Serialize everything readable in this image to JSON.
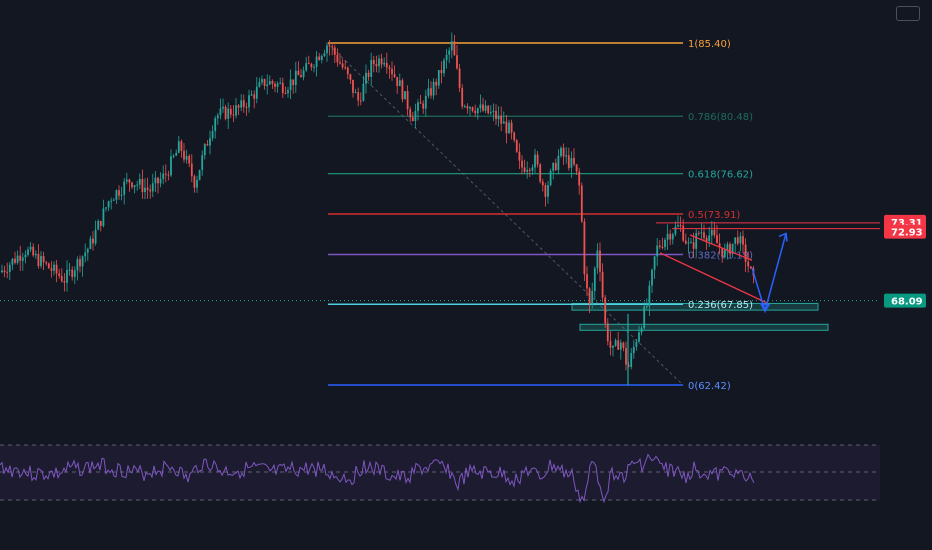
{
  "colors": {
    "background": "#131722",
    "candle_up": "#26a69a",
    "candle_down": "#ef5350",
    "rsi_line": "#7e57c2",
    "rsi_band": "#2a2240",
    "arrow": "#2962ff"
  },
  "fib_levels": [
    {
      "ratio": "1",
      "price": 85.4,
      "label": "1(85.40)",
      "color": "#f7a037",
      "label_color": "#f7a037",
      "line_width": 1.5
    },
    {
      "ratio": "0.786",
      "price": 80.48,
      "label": "0.786(80.48)",
      "color": "#1e6b5a",
      "label_color": "#1e6b5a",
      "line_width": 1.2
    },
    {
      "ratio": "0.618",
      "price": 76.62,
      "label": "0.618(76.62)",
      "color": "#1d9e80",
      "label_color": "#26a69a",
      "line_width": 1.2
    },
    {
      "ratio": "0.5",
      "price": 73.91,
      "label": "0.5(73.91)",
      "color": "#d32f2f",
      "label_color": "#d32f2f",
      "line_width": 1.5
    },
    {
      "ratio": "0.382",
      "price": 71.19,
      "label": "0.382(71.19)",
      "color": "#7e57c2",
      "label_color": "#5c6bc0",
      "line_width": 1.5
    },
    {
      "ratio": "0.236",
      "price": 67.85,
      "label": "0.236(67.85)",
      "color": "#4dd0e1",
      "label_color": "#b2ebf2",
      "line_width": 1.5
    },
    {
      "ratio": "0",
      "price": 62.42,
      "label": "0(62.42)",
      "color": "#2962ff",
      "label_color": "#5b8cff",
      "line_width": 1.5
    }
  ],
  "price_tags": [
    {
      "value": "73.31",
      "price": 73.31,
      "color": "#f23645"
    },
    {
      "value": "72.93",
      "price": 72.93,
      "color": "#f23645"
    },
    {
      "value": "68.09",
      "price": 68.09,
      "color": "#089981"
    }
  ],
  "current_price": 68.09,
  "zones": [
    {
      "from_price": 67.9,
      "to_price": 67.45,
      "color": "#26a69a"
    },
    {
      "from_price": 66.5,
      "to_price": 66.1,
      "color": "#26a69a"
    }
  ],
  "chart_data": {
    "type": "candlestick",
    "title": "",
    "price_range": [
      62.42,
      85.4
    ],
    "key_points": [
      {
        "point": "left start",
        "price": 70.0
      },
      {
        "point": "swing high",
        "price": 85.4
      },
      {
        "point": "swing low",
        "price": 62.42
      },
      {
        "point": "consolidation high",
        "price": 73.31
      },
      {
        "point": "last close",
        "price": 68.09
      }
    ],
    "rsi": {
      "upper_band": 70,
      "mid": 50,
      "lower_band": 30
    }
  }
}
